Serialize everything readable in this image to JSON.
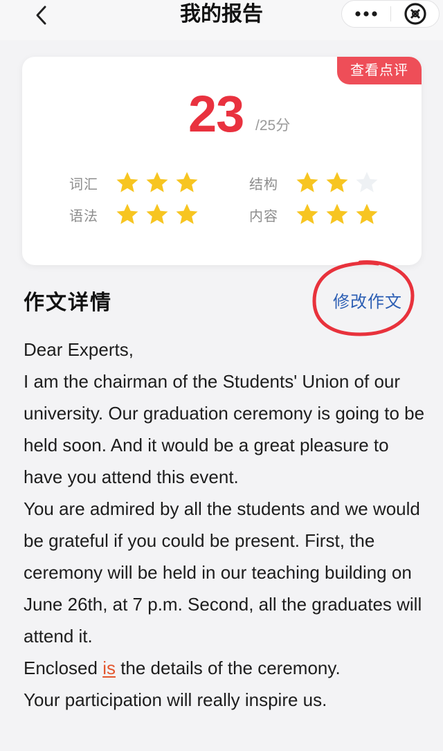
{
  "header": {
    "title": "我的报告",
    "back_icon": "chevron-left-icon",
    "more_icon": "more-dots-icon",
    "close_icon": "close-circle-icon"
  },
  "score_card": {
    "review_button": "查看点评",
    "score": "23",
    "total": "/25分",
    "score_color": "#e9323f",
    "ratings": [
      {
        "label": "词汇",
        "stars": 3,
        "max": 3
      },
      {
        "label": "结构",
        "stars": 2,
        "max": 3
      },
      {
        "label": "语法",
        "stars": 3,
        "max": 3
      },
      {
        "label": "内容",
        "stars": 3,
        "max": 3
      }
    ]
  },
  "essay_section": {
    "title": "作文详情",
    "edit_button": "修改作文",
    "salutation": "Dear Experts,",
    "para1": "I am the chairman of the Students' Union of our university. Our graduation ceremony is going to be held soon. And it would be a great pleasure to have you attend this event.",
    "para2": "You are admired by all the students and we would be grateful if you could be present. First, the ceremony will be held in our teaching building on June 26th, at 7 p.m. Second, all the graduates will attend it.",
    "para3_before": "Enclosed ",
    "para3_error": "is",
    "para3_after": " the details of the ceremony.",
    "para4": "Your participation will really inspire us."
  },
  "colors": {
    "accent_red": "#ee4e58",
    "link_blue": "#2d5fb4",
    "star_gold": "#f7c521",
    "star_empty": "#eef1f4",
    "error_orange": "#e3562e"
  }
}
